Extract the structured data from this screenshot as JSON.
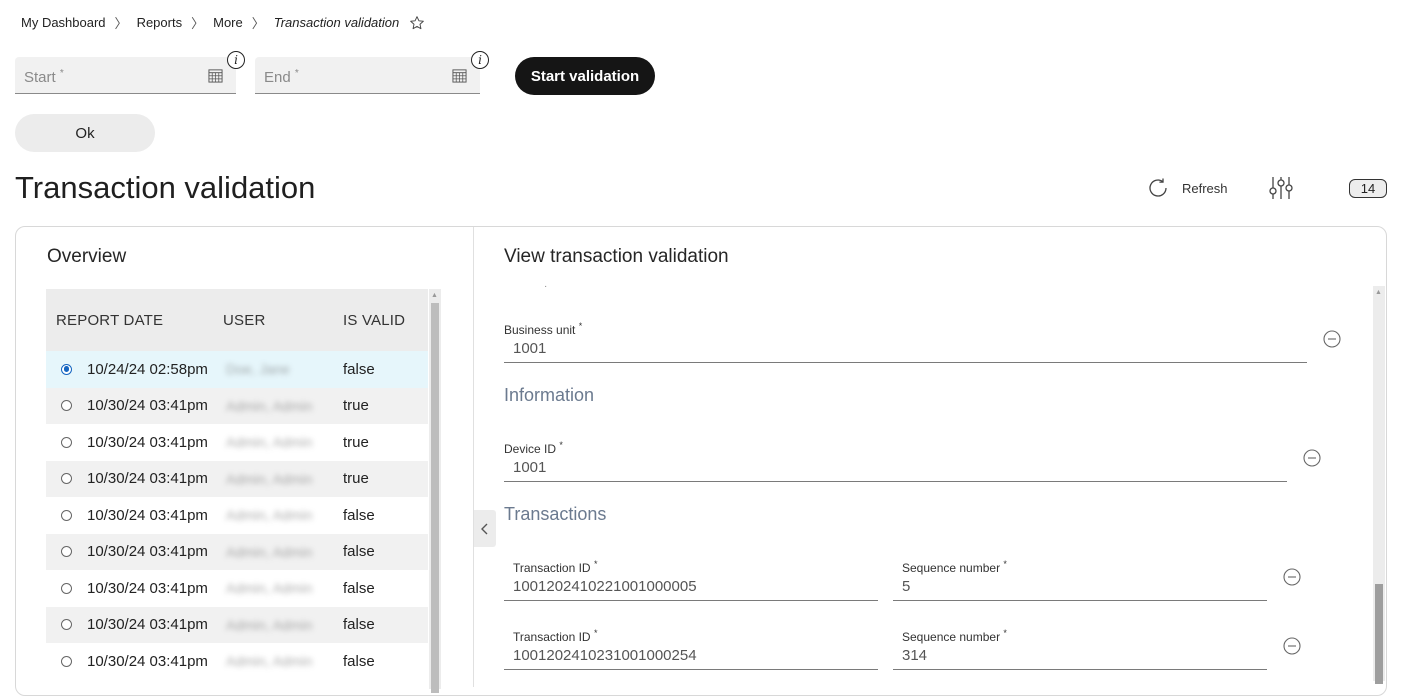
{
  "breadcrumb": [
    "My Dashboard",
    "Reports",
    "More",
    "Transaction validation"
  ],
  "filters": {
    "start_label": "Start",
    "end_label": "End",
    "required_mark": "*",
    "start_button": "Start validation",
    "ok_button": "Ok"
  },
  "page_title": "Transaction validation",
  "toolbar": {
    "refresh_label": "Refresh",
    "count": "14"
  },
  "overview": {
    "title": "Overview",
    "columns": [
      "REPORT DATE",
      "USER",
      "IS VALID"
    ],
    "rows": [
      {
        "date": "10/24/24 02:58pm",
        "user": "Doe, Jane",
        "valid": "false",
        "selected": true
      },
      {
        "date": "10/30/24 03:41pm",
        "user": "Admin, Admin",
        "valid": "true",
        "selected": false
      },
      {
        "date": "10/30/24 03:41pm",
        "user": "Admin, Admin",
        "valid": "true",
        "selected": false
      },
      {
        "date": "10/30/24 03:41pm",
        "user": "Admin, Admin",
        "valid": "true",
        "selected": false
      },
      {
        "date": "10/30/24 03:41pm",
        "user": "Admin, Admin",
        "valid": "false",
        "selected": false
      },
      {
        "date": "10/30/24 03:41pm",
        "user": "Admin, Admin",
        "valid": "false",
        "selected": false
      },
      {
        "date": "10/30/24 03:41pm",
        "user": "Admin, Admin",
        "valid": "false",
        "selected": false
      },
      {
        "date": "10/30/24 03:41pm",
        "user": "Admin, Admin",
        "valid": "false",
        "selected": false
      },
      {
        "date": "10/30/24 03:41pm",
        "user": "Admin, Admin",
        "valid": "false",
        "selected": false
      }
    ]
  },
  "detail": {
    "title": "View transaction validation",
    "business_unit": {
      "label": "Business unit",
      "value": "1001"
    },
    "information_heading": "Information",
    "device_id": {
      "label": "Device ID",
      "value": "1001"
    },
    "transactions_heading": "Transactions",
    "transactions": [
      {
        "id_label": "Transaction ID",
        "id": "1001202410221001000005",
        "seq_label": "Sequence number",
        "seq": "5"
      },
      {
        "id_label": "Transaction ID",
        "id": "1001202410231001000254",
        "seq_label": "Sequence number",
        "seq": "314"
      }
    ]
  },
  "colors": {
    "primary_button": "#151515",
    "selected_row": "#e6f6fb",
    "radio_selected": "#1565c0",
    "section_heading": "#6b7a8f"
  }
}
